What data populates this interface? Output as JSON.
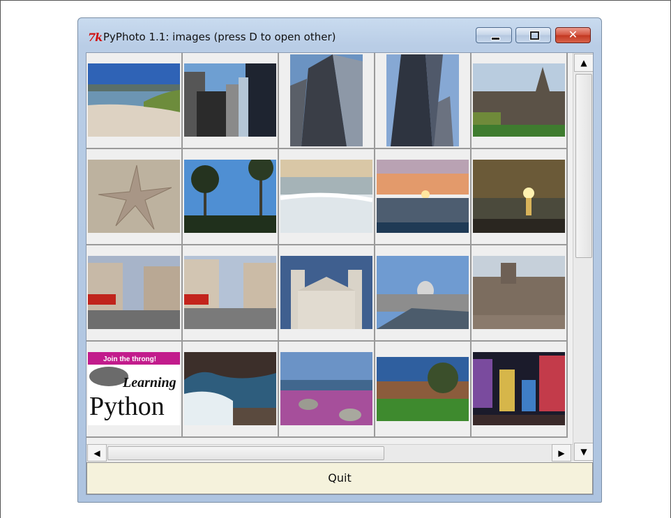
{
  "window": {
    "tk_logo": "7k",
    "title": "PyPhoto 1.1: images  (press D to open other)",
    "controls": {
      "minimize_icon": "minimize-icon",
      "maximize_icon": "maximize-icon",
      "close_icon": "close-icon",
      "close_glyph": "✕"
    }
  },
  "thumbnails": [
    {
      "name": "beach-dunes"
    },
    {
      "name": "city-towers"
    },
    {
      "name": "skyscraper-up"
    },
    {
      "name": "skyscraper-up-2"
    },
    {
      "name": "cathedral"
    },
    {
      "name": "starfish"
    },
    {
      "name": "palm-trees"
    },
    {
      "name": "beach-foam"
    },
    {
      "name": "sunset-sea"
    },
    {
      "name": "sunset-gold"
    },
    {
      "name": "london-street"
    },
    {
      "name": "london-square"
    },
    {
      "name": "st-pauls-front"
    },
    {
      "name": "st-pauls-bridge"
    },
    {
      "name": "tower-of-london"
    },
    {
      "name": "learning-python-cover",
      "banner": "Join the throng!",
      "line1": "Learning",
      "line2": "Python"
    },
    {
      "name": "rocky-coast"
    },
    {
      "name": "pink-flower-coast"
    },
    {
      "name": "park-trees"
    },
    {
      "name": "times-square"
    }
  ],
  "scrollbars": {
    "up_arrow": "▲",
    "down_arrow": "▼",
    "left_arrow": "◀",
    "right_arrow": "▶"
  },
  "quit_button": {
    "label": "Quit"
  }
}
